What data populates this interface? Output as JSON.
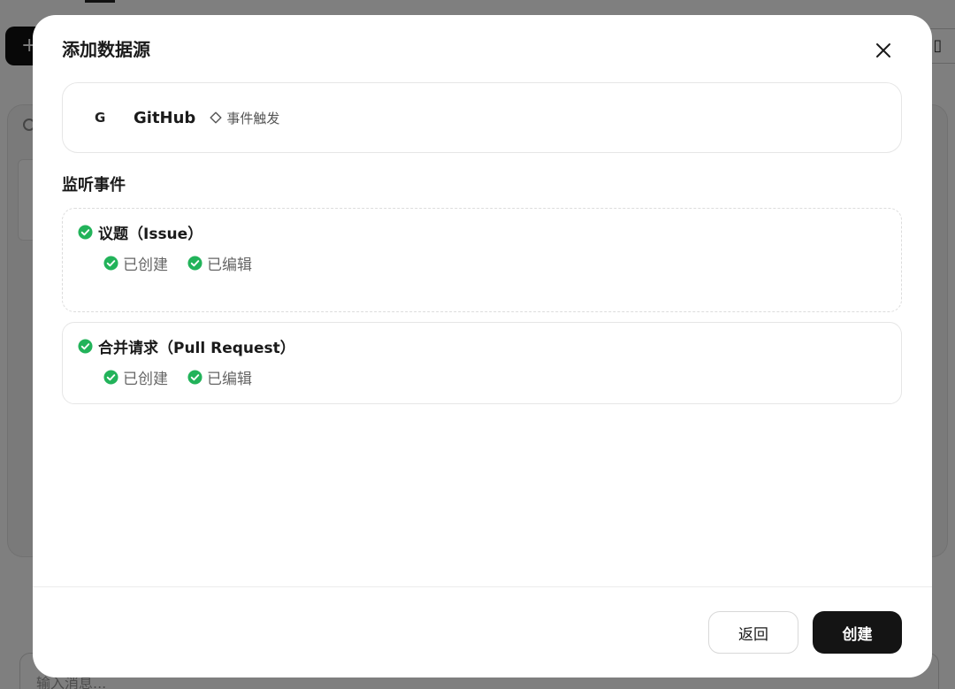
{
  "background": {
    "new_button_icon": "+",
    "right_control_icon": "▯",
    "input_placeholder": "输入消息..."
  },
  "modal": {
    "title": "添加数据源",
    "close_icon": "close-icon",
    "source": {
      "logo_text": "G",
      "name": "GitHub",
      "trigger_label": "事件触发",
      "trigger_icon": "diamond-outline-icon"
    },
    "events_label": "监听事件",
    "event_groups": [
      {
        "title": "议题（Issue）",
        "sub_events": [
          "已创建",
          "已编辑"
        ]
      },
      {
        "title": "合并请求（Pull Request）",
        "sub_events": [
          "已创建",
          "已编辑"
        ]
      }
    ],
    "buttons": {
      "back": "返回",
      "create": "创建"
    }
  },
  "colors": {
    "check_green": "#22b35a",
    "primary_button": "#141414",
    "overlay": "rgba(0,0,0,0.5)"
  }
}
